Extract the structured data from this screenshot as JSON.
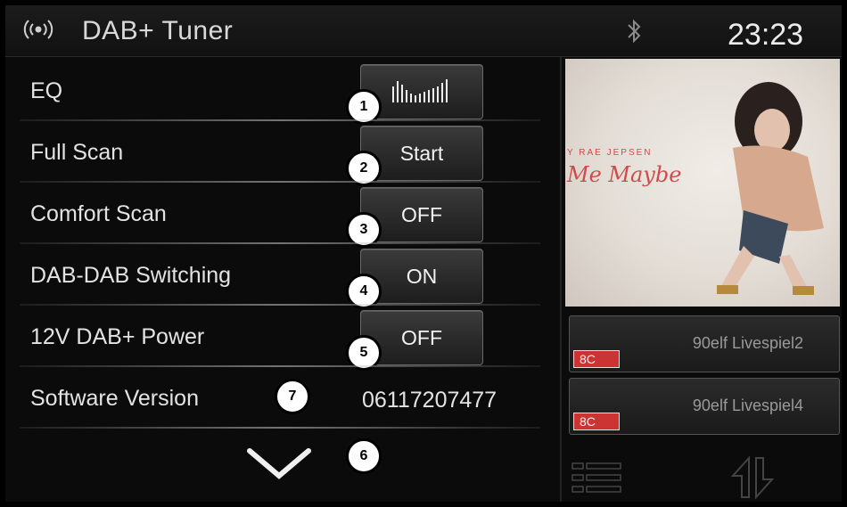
{
  "header": {
    "title": "DAB+ Tuner",
    "clock": "23:23"
  },
  "settings": [
    {
      "label": "EQ",
      "button": "",
      "marker": "1"
    },
    {
      "label": "Full Scan",
      "button": "Start",
      "marker": "2"
    },
    {
      "label": "Comfort Scan",
      "button": "OFF",
      "marker": "3"
    },
    {
      "label": "DAB-DAB Switching",
      "button": "ON",
      "marker": "4"
    },
    {
      "label": "12V DAB+ Power",
      "button": "OFF",
      "marker": "5"
    }
  ],
  "software": {
    "label": "Software Version",
    "value": "06117207477",
    "marker": "7"
  },
  "scroll_marker": "6",
  "album": {
    "artist": "Y RAE JEPSEN",
    "song": "Me Maybe"
  },
  "stations": [
    {
      "name": "90elf Livespiel2",
      "channel": "8C"
    },
    {
      "name": "90elf Livespiel4",
      "channel": "8C"
    }
  ],
  "icons": {
    "radio": "broadcast-icon",
    "bluetooth": "bluetooth-icon",
    "eq": "equalizer-bars-icon",
    "scroll": "chevron-down-icon",
    "list": "list-icon",
    "swap": "swap-arrows-icon"
  },
  "colors": {
    "badge": "#cc3333",
    "text": "#e3e3e3",
    "background": "#0b0b0b"
  }
}
